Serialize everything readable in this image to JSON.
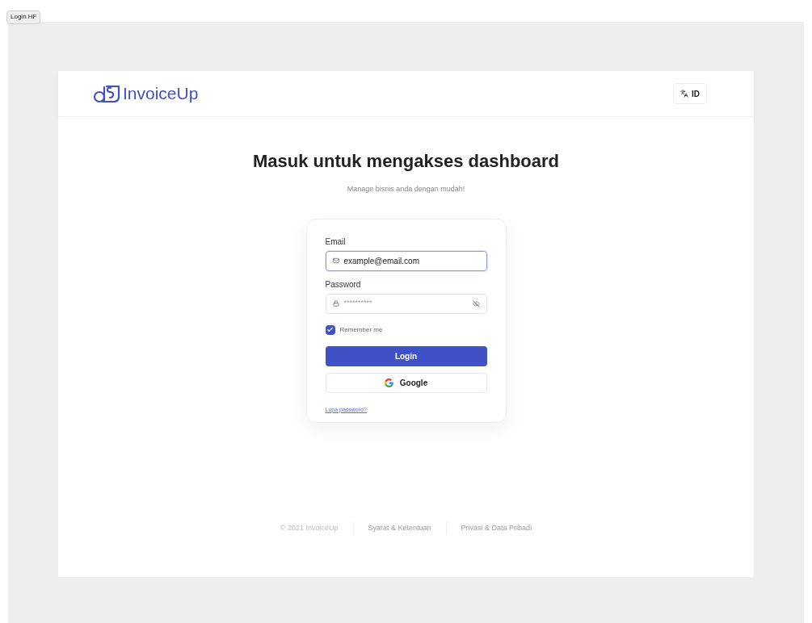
{
  "top_button": "Login HF",
  "header": {
    "logo_text": "InvoiceUp",
    "language": "ID"
  },
  "title": "Masuk untuk mengakses dashboard",
  "subtitle": "Manage bisnis anda dengan mudah!",
  "form": {
    "email": {
      "label": "Email",
      "value": "example@email.com",
      "focused": true
    },
    "password": {
      "label": "Password",
      "placeholder": "**********"
    },
    "remember": {
      "label": "Remember me",
      "checked": true
    },
    "login_button": "Login",
    "google_button": "Google",
    "forgot_link": "Lupa password?"
  },
  "footer": [
    "© 2021 InvoiceUp",
    "Syarat & Ketentuan",
    "Privasi & Data Pribadi"
  ]
}
